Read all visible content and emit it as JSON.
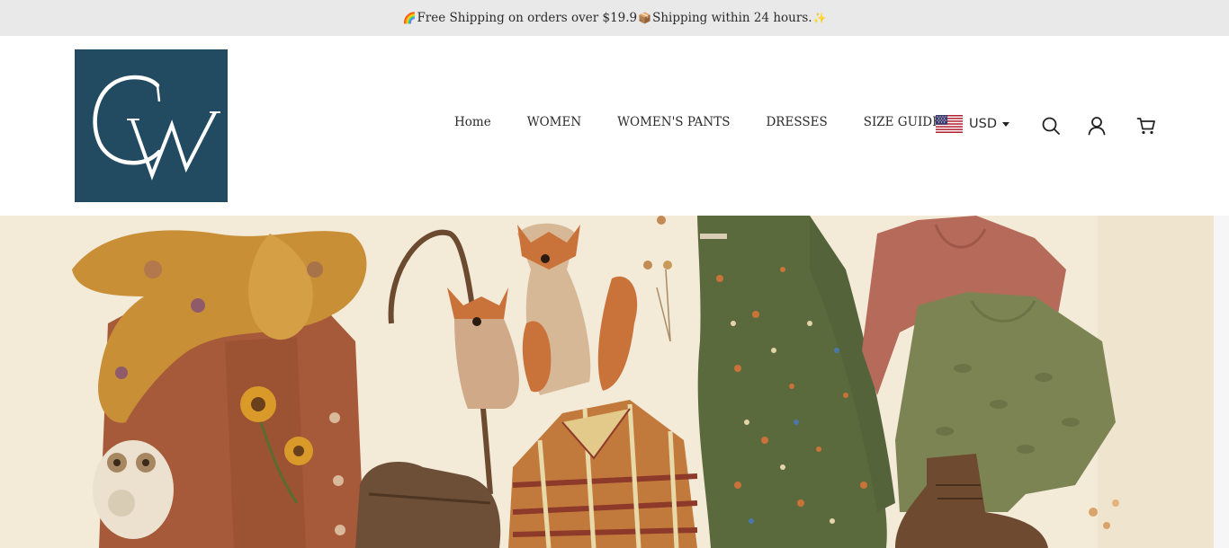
{
  "announcement": {
    "icon_left": "rainbow-icon",
    "text_1": "Free Shipping on orders over $19.9 ",
    "icon_middle": "package-icon",
    "text_2": "Shipping within 24 hours.",
    "icon_right": "sparkle-icon"
  },
  "brand": {
    "logo_letters": "CW",
    "logo_bg": "#224b61"
  },
  "nav": {
    "items": [
      {
        "label": "Home"
      },
      {
        "label": "WOMEN"
      },
      {
        "label": "WOMEN'S PANTS"
      },
      {
        "label": "DRESSES"
      },
      {
        "label": "SIZE GUIDE"
      }
    ]
  },
  "currency": {
    "selected": "USD",
    "flag": "us-flag-icon"
  },
  "header_icons": {
    "search": "search-icon",
    "account": "user-icon",
    "cart": "cart-icon"
  },
  "hero": {
    "description_icon": "autumn-clothing-flatlay-image",
    "colors": {
      "background": "#f3ead8",
      "scarf": "#c98f36",
      "cardigan": "#a65a3a",
      "dress": "#5b6a3c",
      "pink_top": "#b56a5a",
      "green_top": "#7d8454"
    }
  }
}
